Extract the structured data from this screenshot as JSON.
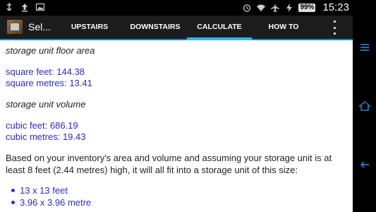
{
  "status_bar": {
    "battery": "99%",
    "time": "15:23"
  },
  "action_bar": {
    "app_title": "Sel...",
    "tabs": [
      {
        "label": "UPSTAIRS",
        "active": false
      },
      {
        "label": "DOWNSTAIRS",
        "active": false
      },
      {
        "label": "CALCULATE",
        "active": true
      },
      {
        "label": "HOW TO",
        "active": false
      }
    ]
  },
  "content": {
    "floor_area_heading": "storage unit floor area",
    "square_feet": "square feet: 144.38",
    "square_metres": "square metres: 13.41",
    "volume_heading": "storage unit volume",
    "cubic_feet": "cubic feet: 686.19",
    "cubic_metres": "cubic metres: 19.43",
    "summary_line1": "Based on your inventory's area and volume and assuming your storage unit is at",
    "summary_line2": "least 8 feet (2.44 metres) high, it will all fit into a storage unit of this size:",
    "unit_sizes": [
      "13 x 13 feet",
      "3.96 x 3.96 metre"
    ]
  },
  "colors": {
    "accent": "#33b5e5",
    "link_blue": "#2a2ad6",
    "nav_icon_blue": "#1e6fb0"
  }
}
